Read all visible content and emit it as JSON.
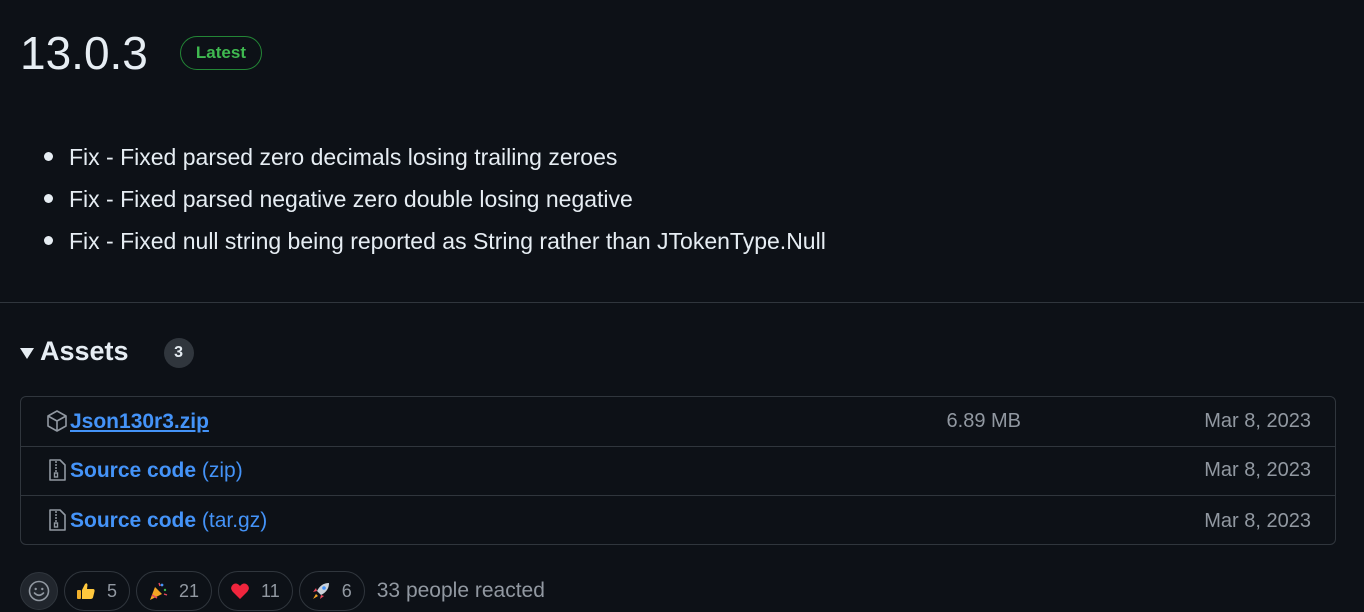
{
  "release": {
    "version": "13.0.3",
    "badge": "Latest"
  },
  "notes": [
    "Fix - Fixed parsed zero decimals losing trailing zeroes",
    "Fix - Fixed parsed negative zero double losing negative",
    "Fix - Fixed null string being reported as String rather than JTokenType.Null"
  ],
  "assets": {
    "title": "Assets",
    "count": "3",
    "items": [
      {
        "name": "Json130r3.zip",
        "suffix": "",
        "size": "6.89 MB",
        "date": "Mar 8, 2023",
        "icon": "package-icon"
      },
      {
        "name": "Source code",
        "suffix": " (zip)",
        "size": "",
        "date": "Mar 8, 2023",
        "icon": "file-zip-icon"
      },
      {
        "name": "Source code",
        "suffix": " (tar.gz)",
        "size": "",
        "date": "Mar 8, 2023",
        "icon": "file-zip-icon"
      }
    ]
  },
  "reactions": {
    "items": [
      {
        "emoji": "thumbs-up",
        "count": "5"
      },
      {
        "emoji": "party-popper",
        "count": "21"
      },
      {
        "emoji": "heart",
        "count": "11"
      },
      {
        "emoji": "rocket",
        "count": "6"
      }
    ],
    "summary": "33 people reacted"
  },
  "colors": {
    "background": "#0d1117",
    "link": "#4493f8",
    "latest_green": "#3fb950",
    "muted": "#9198a1",
    "border": "#30363d"
  }
}
